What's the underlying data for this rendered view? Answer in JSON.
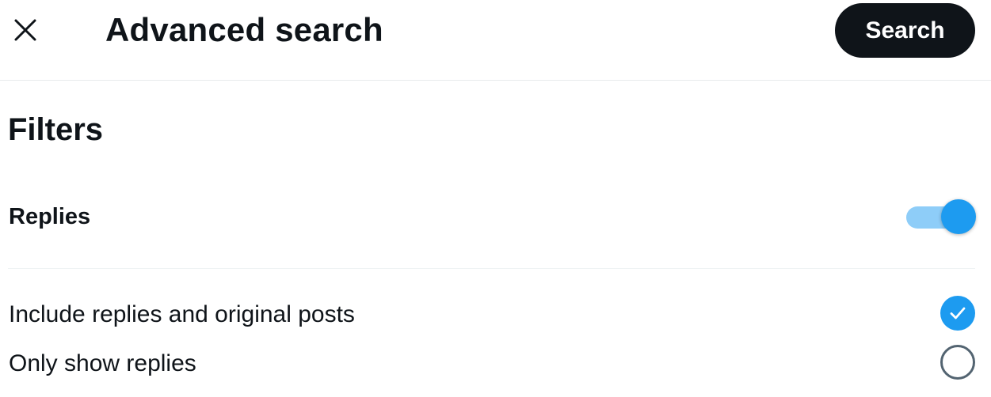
{
  "header": {
    "close_icon": "close-icon",
    "title": "Advanced search",
    "search_button": "Search"
  },
  "filters": {
    "heading": "Filters",
    "replies": {
      "label": "Replies",
      "toggle_on": true,
      "toggle_color": "#1d9bf0"
    },
    "options": [
      {
        "label": "Include replies and original posts",
        "selected": true,
        "icon": "check-circle-icon"
      },
      {
        "label": "Only show replies",
        "selected": false,
        "icon": "empty-circle-icon"
      }
    ]
  },
  "colors": {
    "accent": "#1d9bf0",
    "text": "#0f1419",
    "button_bg": "#0f1419"
  }
}
